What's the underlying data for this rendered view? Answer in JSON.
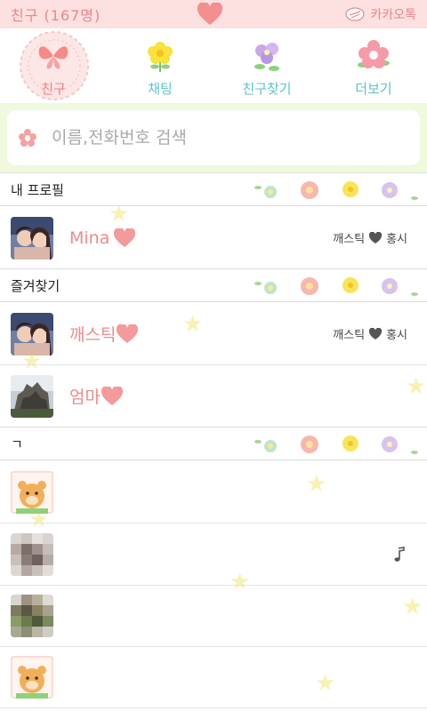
{
  "status_bar": {
    "title": "친구 (167명)",
    "brand": "카카오톡",
    "heart_icon": "heart-icon",
    "brand_icon": "kakao-bird-icon"
  },
  "tabs": [
    {
      "label": "친구",
      "icon": "butterfly-icon",
      "active": true
    },
    {
      "label": "채팅",
      "icon": "yellow-flower-icon",
      "active": false
    },
    {
      "label": "친구찾기",
      "icon": "purple-flowers-icon",
      "active": false
    },
    {
      "label": "더보기",
      "icon": "pink-flower-icon",
      "active": false
    }
  ],
  "search": {
    "placeholder": "이름,전화번호 검색"
  },
  "sections": {
    "my_profile": "내 프로필",
    "favorites": "즐겨찾기",
    "giyeok": "ㄱ"
  },
  "my_profile": {
    "name": "Mina",
    "status_prefix": "깨스틱",
    "status_suffix": "홍시"
  },
  "favorites": [
    {
      "name": "깨스틱",
      "status_prefix": "깨스틱",
      "status_suffix": "홍시"
    },
    {
      "name": "엄마",
      "status_prefix": "",
      "status_suffix": ""
    }
  ],
  "colors": {
    "status_bar": "#fde0e0",
    "accent_pink": "#ef7f86",
    "tab_teal": "#5cc3c8",
    "search_bg": "#eef9dd"
  }
}
